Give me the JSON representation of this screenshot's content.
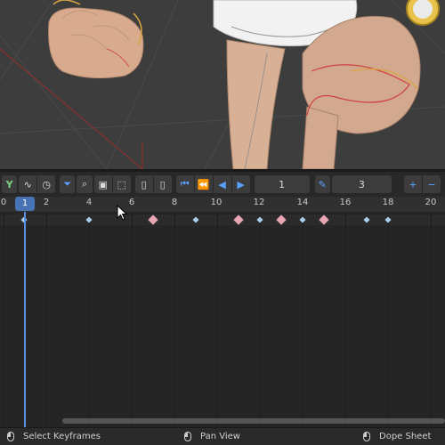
{
  "viewport": {
    "description_icon": "3d-viewport-character"
  },
  "toolbar": {
    "current_frame_field": "1",
    "step_field": "3",
    "icons": [
      "channels-icon",
      "curve-icon",
      "clock-icon",
      "filter-icon",
      "search-icon",
      "frame-all-icon",
      "select-box-icon",
      "mouse-left-icon",
      "mouse-right-icon",
      "jump-start-icon",
      "prev-key-icon",
      "play-reverse-icon",
      "play-icon",
      "brush-icon",
      "plus-icon",
      "minus-icon"
    ]
  },
  "ruler": {
    "current_frame": "1",
    "ticks": [
      "0",
      "2",
      "4",
      "6",
      "8",
      "10",
      "12",
      "14",
      "16",
      "18",
      "20"
    ]
  },
  "keyframes": {
    "small_frames": [
      0,
      4,
      9,
      12,
      14,
      17,
      18
    ],
    "big_frames": [
      7,
      11,
      13,
      15
    ]
  },
  "statusbar": {
    "select": "Select Keyframes",
    "pan": "Pan View",
    "sheet": "Dope Sheet"
  },
  "colors": {
    "accent": "#4772b3",
    "playhead": "#5b8fdf",
    "small_key": "#a8cfe8",
    "big_key": "#e8a6b4"
  }
}
